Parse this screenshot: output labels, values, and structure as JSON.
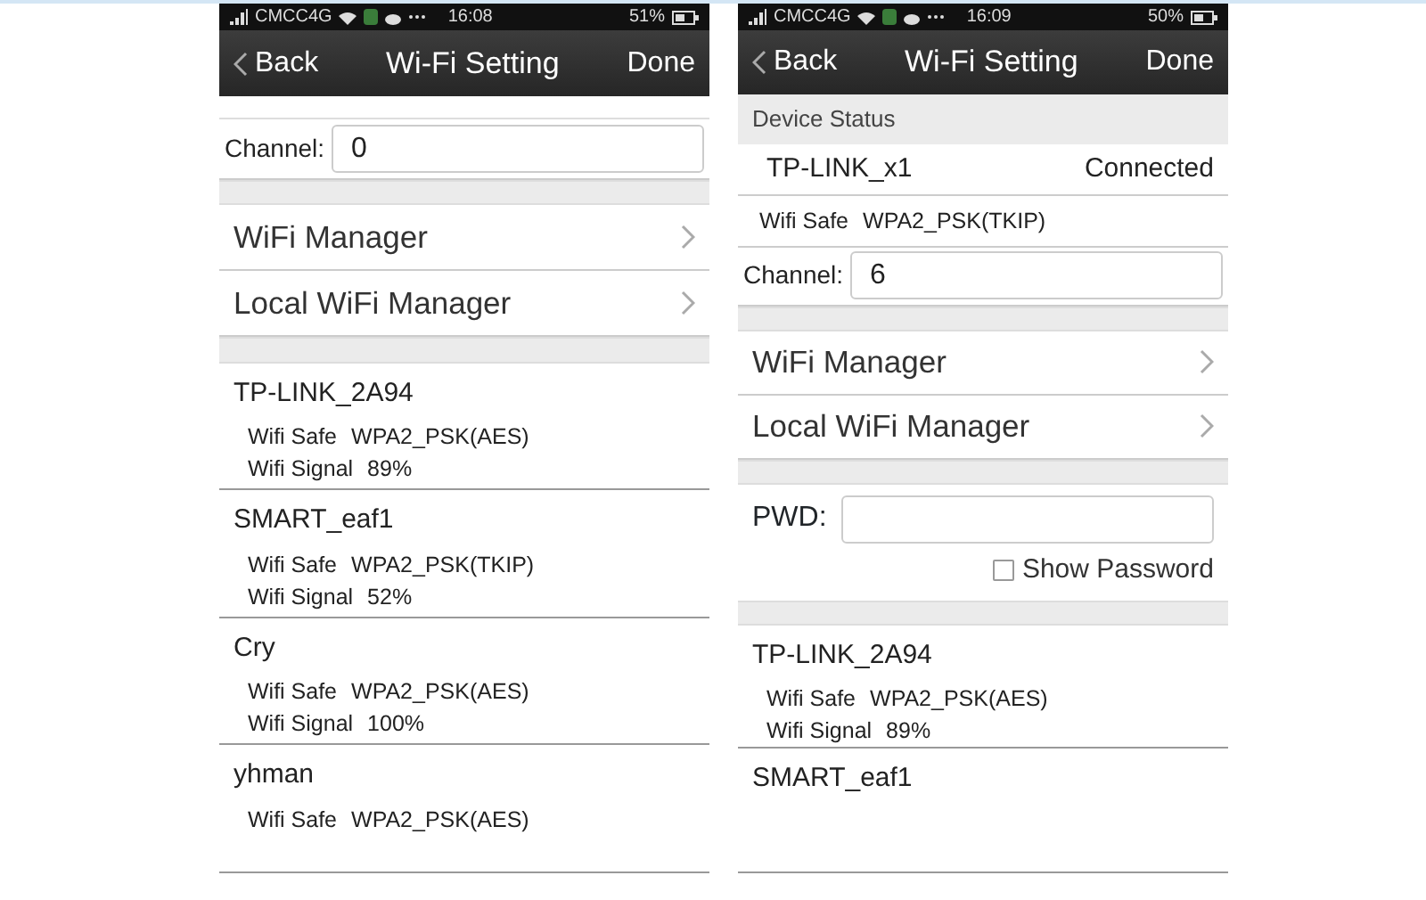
{
  "phones": [
    {
      "status_bar": {
        "carrier": "CMCC4G",
        "time": "16:08",
        "battery": "51%"
      },
      "nav": {
        "back": "Back",
        "title": "Wi-Fi Setting",
        "done": "Done"
      },
      "blocks": [
        {
          "kind": "spacer"
        },
        {
          "kind": "channel",
          "label": "Channel:",
          "value": "0"
        },
        {
          "kind": "gap"
        },
        {
          "kind": "menu",
          "items": [
            "WiFi Manager",
            "Local WiFi Manager"
          ]
        },
        {
          "kind": "gap"
        },
        {
          "kind": "networks",
          "items": [
            {
              "name": "TP-LINK_2A94",
              "safe_label": "Wifi Safe",
              "safe": "WPA2_PSK(AES)",
              "signal_label": "Wifi Signal",
              "signal": "89%"
            },
            {
              "name": "SMART_eaf1",
              "safe_label": "Wifi Safe",
              "safe": "WPA2_PSK(TKIP)",
              "signal_label": "Wifi Signal",
              "signal": "52%"
            },
            {
              "name": "Cry",
              "safe_label": "Wifi Safe",
              "safe": "WPA2_PSK(AES)",
              "signal_label": "Wifi Signal",
              "signal": "100%"
            },
            {
              "name": "yhman",
              "safe_label": "Wifi Safe",
              "safe": "WPA2_PSK(AES)"
            }
          ]
        }
      ]
    },
    {
      "status_bar": {
        "carrier": "CMCC4G",
        "time": "16:09",
        "battery": "50%"
      },
      "nav": {
        "back": "Back",
        "title": "Wi-Fi Setting",
        "done": "Done"
      },
      "blocks": [
        {
          "kind": "header",
          "label": "Device Status"
        },
        {
          "kind": "device",
          "name": "TP-LINK_x1",
          "status": "Connected",
          "safe_label": "Wifi Safe",
          "safe": "WPA2_PSK(TKIP)"
        },
        {
          "kind": "channel",
          "label": "Channel:",
          "value": "6"
        },
        {
          "kind": "gap"
        },
        {
          "kind": "menu",
          "items": [
            "WiFi Manager",
            "Local WiFi Manager"
          ]
        },
        {
          "kind": "gap"
        },
        {
          "kind": "password",
          "label": "PWD:",
          "show_label": "Show Password",
          "checked": false
        },
        {
          "kind": "gap"
        },
        {
          "kind": "networks",
          "items": [
            {
              "name": "TP-LINK_2A94",
              "safe_label": "Wifi Safe",
              "safe": "WPA2_PSK(AES)",
              "signal_label": "Wifi Signal",
              "signal": "89%"
            },
            {
              "name": "SMART_eaf1"
            }
          ]
        }
      ]
    }
  ]
}
